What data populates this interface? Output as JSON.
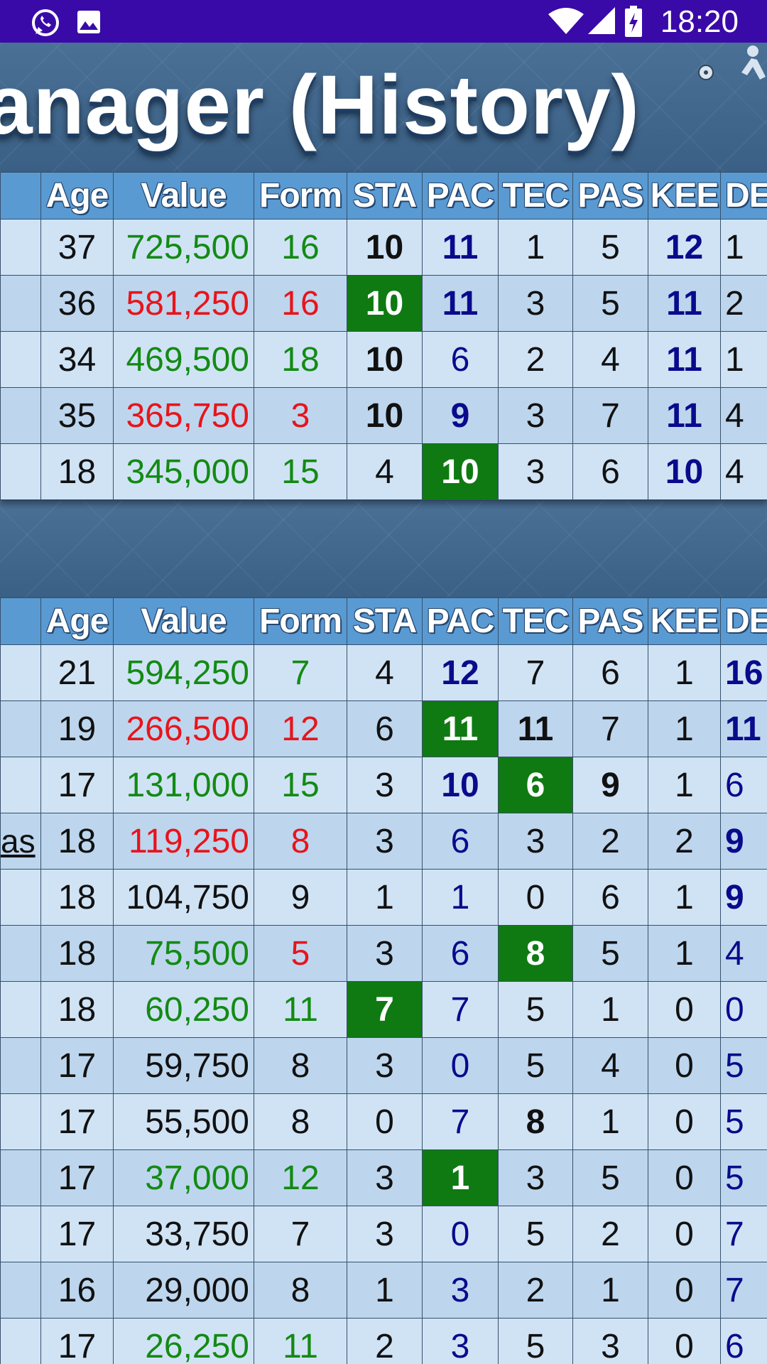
{
  "status_bar": {
    "left_icons": [
      "whatsapp-icon",
      "gallery-icon"
    ],
    "right_icons": [
      "wifi-icon",
      "signal-icon",
      "battery-charging-icon"
    ],
    "time": "18:20",
    "color": "#3a0aa8"
  },
  "header": {
    "title": "anager (History)"
  },
  "colors": {
    "green_value": "#138a13",
    "red_value": "#e8141b",
    "navy_stat": "#0a0a8c",
    "highlight_cell": "#0f7a12",
    "header_cell": "#5a9ad2"
  },
  "columns": [
    "",
    "Age",
    "Value",
    "Form",
    "STA",
    "PAC",
    "TEC",
    "PAS",
    "KEE",
    "DE"
  ],
  "table1": {
    "rows": [
      {
        "name": "",
        "age": "37",
        "value": "725,500",
        "value_color": "g",
        "form": "16",
        "form_color": "g",
        "stats": [
          [
            "10",
            "k b"
          ],
          [
            "11",
            "nv b"
          ],
          [
            "1",
            "k"
          ],
          [
            "5",
            "k"
          ],
          [
            "12",
            "nv b"
          ],
          [
            "1",
            "k"
          ]
        ]
      },
      {
        "name": "",
        "age": "36",
        "value": "581,250",
        "value_color": "r",
        "form": "16",
        "form_color": "r",
        "stats": [
          [
            "10",
            "hl"
          ],
          [
            "11",
            "nv b"
          ],
          [
            "3",
            "k"
          ],
          [
            "5",
            "k"
          ],
          [
            "11",
            "nv b"
          ],
          [
            "2",
            "k"
          ]
        ]
      },
      {
        "name": "",
        "age": "34",
        "value": "469,500",
        "value_color": "g",
        "form": "18",
        "form_color": "g",
        "stats": [
          [
            "10",
            "k b"
          ],
          [
            "6",
            "nv"
          ],
          [
            "2",
            "k"
          ],
          [
            "4",
            "k"
          ],
          [
            "11",
            "nv b"
          ],
          [
            "1",
            "k"
          ]
        ]
      },
      {
        "name": "",
        "age": "35",
        "value": "365,750",
        "value_color": "r",
        "form": "3",
        "form_color": "r",
        "stats": [
          [
            "10",
            "k b"
          ],
          [
            "9",
            "nv b"
          ],
          [
            "3",
            "k"
          ],
          [
            "7",
            "k"
          ],
          [
            "11",
            "nv b"
          ],
          [
            "4",
            "k"
          ]
        ]
      },
      {
        "name": "",
        "age": "18",
        "value": "345,000",
        "value_color": "g",
        "form": "15",
        "form_color": "g",
        "stats": [
          [
            "4",
            "k"
          ],
          [
            "10",
            "hl"
          ],
          [
            "3",
            "k"
          ],
          [
            "6",
            "k"
          ],
          [
            "10",
            "nv b"
          ],
          [
            "4",
            "k"
          ]
        ]
      }
    ]
  },
  "table2": {
    "rows": [
      {
        "name": "",
        "age": "21",
        "value": "594,250",
        "value_color": "g",
        "form": "7",
        "form_color": "g",
        "stats": [
          [
            "4",
            "k"
          ],
          [
            "12",
            "nv b"
          ],
          [
            "7",
            "k"
          ],
          [
            "6",
            "k"
          ],
          [
            "1",
            "k"
          ],
          [
            "16",
            "nv b"
          ]
        ]
      },
      {
        "name": "",
        "age": "19",
        "value": "266,500",
        "value_color": "r",
        "form": "12",
        "form_color": "r",
        "stats": [
          [
            "6",
            "k"
          ],
          [
            "11",
            "hl"
          ],
          [
            "11",
            "k b"
          ],
          [
            "7",
            "k"
          ],
          [
            "1",
            "k"
          ],
          [
            "11",
            "nv b"
          ]
        ]
      },
      {
        "name": "",
        "age": "17",
        "value": "131,000",
        "value_color": "g",
        "form": "15",
        "form_color": "g",
        "stats": [
          [
            "3",
            "k"
          ],
          [
            "10",
            "nv b"
          ],
          [
            "6",
            "hl"
          ],
          [
            "9",
            "k b"
          ],
          [
            "1",
            "k"
          ],
          [
            "6",
            "nv"
          ]
        ]
      },
      {
        "name": "as",
        "age": "18",
        "value": "119,250",
        "value_color": "r",
        "form": "8",
        "form_color": "r",
        "stats": [
          [
            "3",
            "k"
          ],
          [
            "6",
            "nv"
          ],
          [
            "3",
            "k"
          ],
          [
            "2",
            "k"
          ],
          [
            "2",
            "k"
          ],
          [
            "9",
            "nv b"
          ]
        ]
      },
      {
        "name": "",
        "age": "18",
        "value": "104,750",
        "value_color": "k",
        "form": "9",
        "form_color": "k",
        "stats": [
          [
            "1",
            "k"
          ],
          [
            "1",
            "nv"
          ],
          [
            "0",
            "k"
          ],
          [
            "6",
            "k"
          ],
          [
            "1",
            "k"
          ],
          [
            "9",
            "nv b"
          ]
        ]
      },
      {
        "name": "",
        "age": "18",
        "value": "75,500",
        "value_color": "g",
        "form": "5",
        "form_color": "r",
        "stats": [
          [
            "3",
            "k"
          ],
          [
            "6",
            "nv"
          ],
          [
            "8",
            "hl"
          ],
          [
            "5",
            "k"
          ],
          [
            "1",
            "k"
          ],
          [
            "4",
            "nv"
          ]
        ]
      },
      {
        "name": "",
        "age": "18",
        "value": "60,250",
        "value_color": "g",
        "form": "11",
        "form_color": "g",
        "stats": [
          [
            "7",
            "hl"
          ],
          [
            "7",
            "nv"
          ],
          [
            "5",
            "k"
          ],
          [
            "1",
            "k"
          ],
          [
            "0",
            "k"
          ],
          [
            "0",
            "nv"
          ]
        ]
      },
      {
        "name": "",
        "age": "17",
        "value": "59,750",
        "value_color": "k",
        "form": "8",
        "form_color": "k",
        "stats": [
          [
            "3",
            "k"
          ],
          [
            "0",
            "nv"
          ],
          [
            "5",
            "k"
          ],
          [
            "4",
            "k"
          ],
          [
            "0",
            "k"
          ],
          [
            "5",
            "nv"
          ]
        ]
      },
      {
        "name": "",
        "age": "17",
        "value": "55,500",
        "value_color": "k",
        "form": "8",
        "form_color": "k",
        "stats": [
          [
            "0",
            "k"
          ],
          [
            "7",
            "nv"
          ],
          [
            "8",
            "k b"
          ],
          [
            "1",
            "k"
          ],
          [
            "0",
            "k"
          ],
          [
            "5",
            "nv"
          ]
        ]
      },
      {
        "name": "",
        "age": "17",
        "value": "37,000",
        "value_color": "g",
        "form": "12",
        "form_color": "g",
        "stats": [
          [
            "3",
            "k"
          ],
          [
            "1",
            "hl"
          ],
          [
            "3",
            "k"
          ],
          [
            "5",
            "k"
          ],
          [
            "0",
            "k"
          ],
          [
            "5",
            "nv"
          ]
        ]
      },
      {
        "name": "",
        "age": "17",
        "value": "33,750",
        "value_color": "k",
        "form": "7",
        "form_color": "k",
        "stats": [
          [
            "3",
            "k"
          ],
          [
            "0",
            "nv"
          ],
          [
            "5",
            "k"
          ],
          [
            "2",
            "k"
          ],
          [
            "0",
            "k"
          ],
          [
            "7",
            "nv"
          ]
        ]
      },
      {
        "name": "",
        "age": "16",
        "value": "29,000",
        "value_color": "k",
        "form": "8",
        "form_color": "k",
        "stats": [
          [
            "1",
            "k"
          ],
          [
            "3",
            "nv"
          ],
          [
            "2",
            "k"
          ],
          [
            "1",
            "k"
          ],
          [
            "0",
            "k"
          ],
          [
            "7",
            "nv"
          ]
        ]
      },
      {
        "name": "",
        "age": "17",
        "value": "26,250",
        "value_color": "g",
        "form": "11",
        "form_color": "g",
        "stats": [
          [
            "2",
            "k"
          ],
          [
            "3",
            "nv"
          ],
          [
            "5",
            "k"
          ],
          [
            "3",
            "k"
          ],
          [
            "0",
            "k"
          ],
          [
            "6",
            "nv"
          ]
        ]
      }
    ]
  }
}
